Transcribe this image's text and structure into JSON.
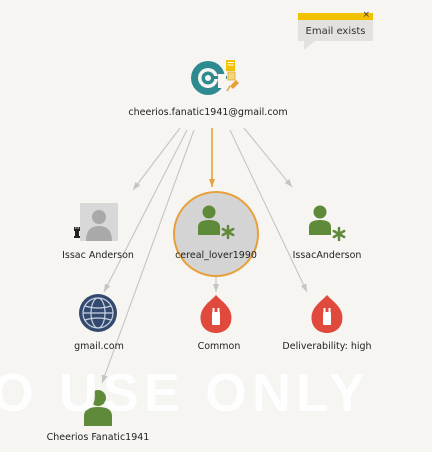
{
  "tooltip": {
    "text": "Email exists",
    "close": "×"
  },
  "watermark": "O USE ONLY",
  "nodes": {
    "email": {
      "label": "cheerios.fanatic1941@gmail.com",
      "icon": "email-at-icon"
    },
    "issac_person": {
      "label": "Issac Anderson",
      "icon": "unknown-person-icon"
    },
    "cereal_lover": {
      "label": "cereal_lover1990",
      "icon": "user-account-icon"
    },
    "issac_account": {
      "label": "IssacAnderson",
      "icon": "user-account-icon"
    },
    "gmail": {
      "label": "gmail.com",
      "icon": "globe-icon"
    },
    "common": {
      "label": "Common",
      "icon": "fire-icon"
    },
    "deliverability": {
      "label": "Deliverability: high",
      "icon": "fire-icon"
    },
    "cheerios_person": {
      "label": "Cheerios Fanatic1941",
      "icon": "person-icon"
    }
  },
  "colors": {
    "teal": "#2e8a8f",
    "green": "#5f8a3a",
    "red": "#e04a3c",
    "navy": "#34496e",
    "orange": "#e8a03a",
    "edge": "#c4c4c4",
    "background": "#f6f5f2",
    "tooltip_bar": "#f2c200"
  }
}
